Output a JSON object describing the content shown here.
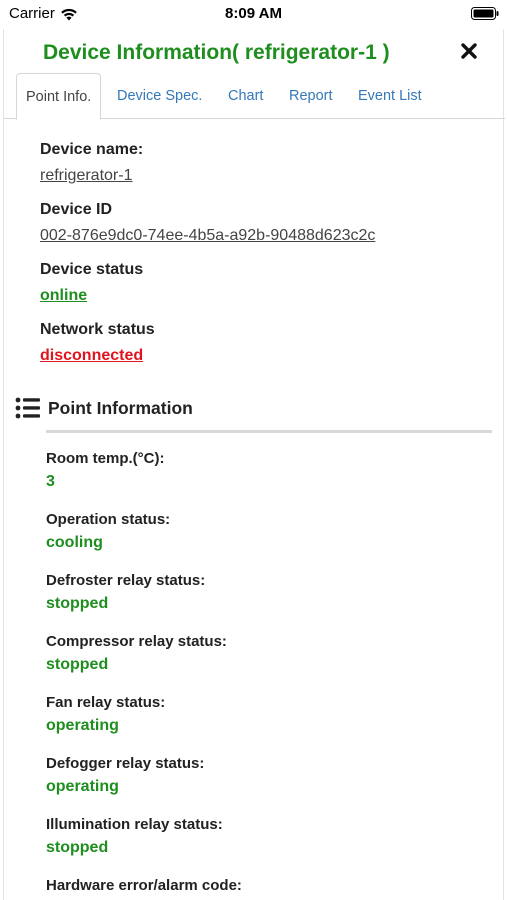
{
  "status_bar": {
    "carrier": "Carrier",
    "time": "8:09 AM"
  },
  "modal": {
    "title": "Device Information( refrigerator-1 )"
  },
  "tabs": [
    {
      "label": "Point Info.",
      "active": true
    },
    {
      "label": "Device Spec.",
      "active": false
    },
    {
      "label": "Chart",
      "active": false
    },
    {
      "label": "Report",
      "active": false
    },
    {
      "label": "Event List",
      "active": false
    }
  ],
  "device": {
    "name_label": "Device name:",
    "name_value": "refrigerator-1",
    "id_label": "Device ID",
    "id_value": "002-876e9dc0-74ee-4b5a-a92b-90488d623c2c",
    "status_label": "Device status",
    "status_value": "online",
    "network_label": "Network status",
    "network_value": "disconnected"
  },
  "point_section": {
    "title": "Point Information",
    "icon": "list-icon",
    "items": [
      {
        "label": "Room temp.(°C):",
        "value": "3"
      },
      {
        "label": "Operation status:",
        "value": "cooling"
      },
      {
        "label": "Defroster relay status:",
        "value": "stopped"
      },
      {
        "label": "Compressor relay status:",
        "value": "stopped"
      },
      {
        "label": "Fan relay status:",
        "value": "operating"
      },
      {
        "label": "Defogger relay status:",
        "value": "operating"
      },
      {
        "label": "Illumination relay status:",
        "value": "stopped"
      },
      {
        "label": "Hardware error/alarm code:",
        "value": ""
      }
    ]
  },
  "colors": {
    "title_green": "#1e8e1e",
    "value_green": "#1e8e1e",
    "alert_red": "#e0141e",
    "tab_blue": "#3578b8"
  }
}
